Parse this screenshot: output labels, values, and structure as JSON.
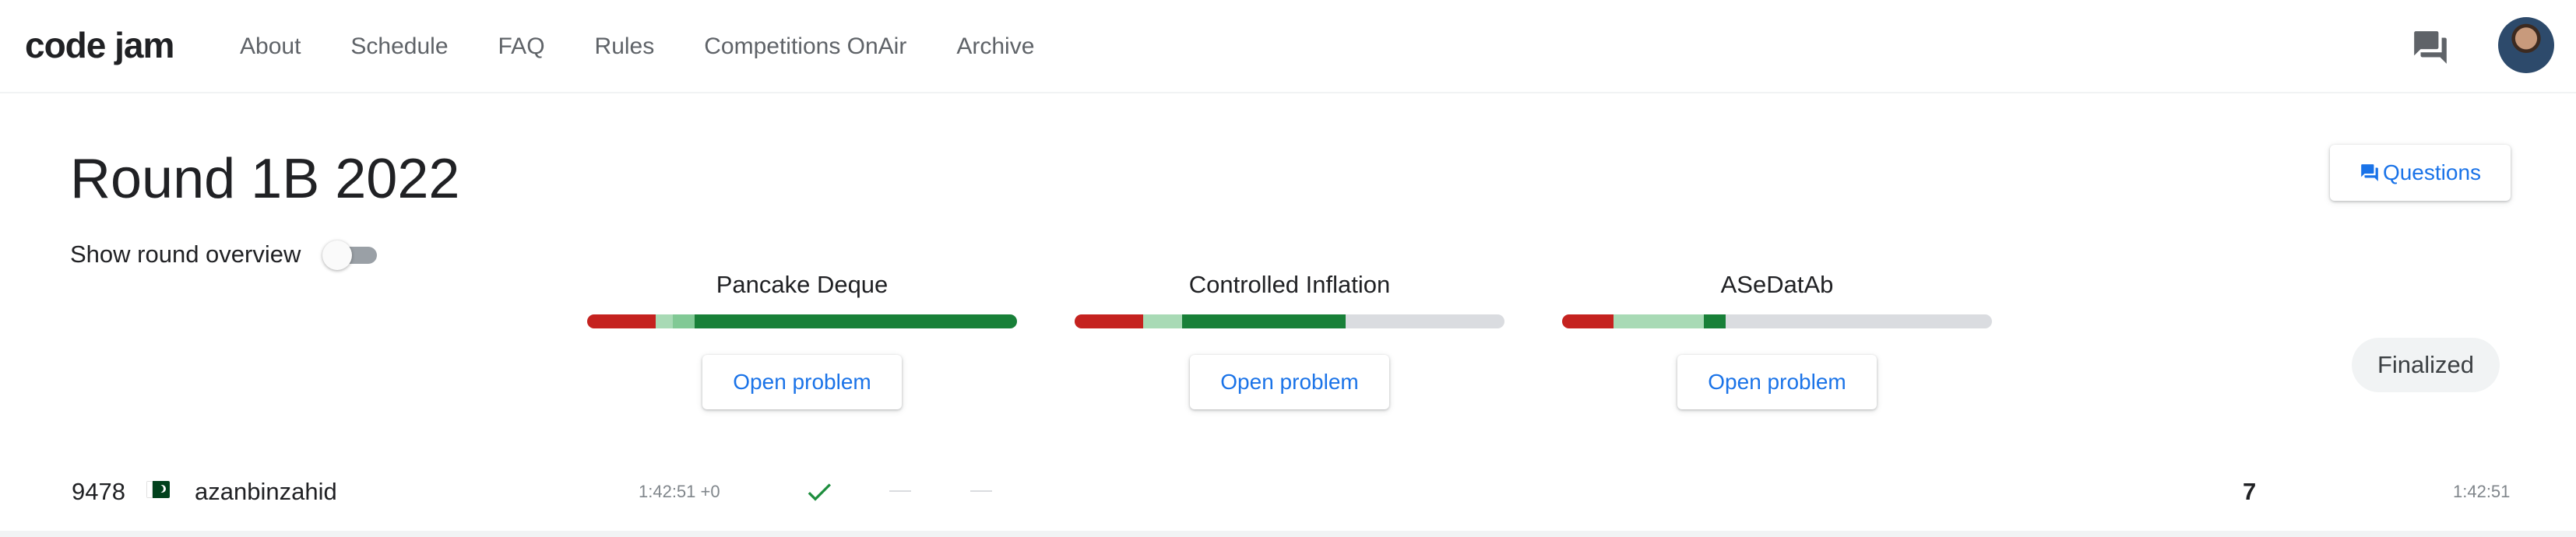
{
  "nav": {
    "brand": "code jam",
    "links": [
      "About",
      "Schedule",
      "FAQ",
      "Rules",
      "Competitions OnAir",
      "Archive"
    ]
  },
  "icons": {
    "chat": "chat-icon",
    "questions": "question-answer-icon",
    "check": "check-icon",
    "flag": "pakistan-flag-icon"
  },
  "colors": {
    "accent": "#1a73e8",
    "solved_green": "#188038",
    "failed_red": "#c5221f",
    "light_green": "#a8dab5",
    "unsolved_gray": "#dadce0"
  },
  "round": {
    "title": "Round 1B 2022",
    "overview_label": "Show round overview",
    "overview_enabled": false,
    "questions_label": "Questions",
    "status": "Finalized"
  },
  "problems": [
    {
      "name": "Pancake Deque",
      "open_label": "Open problem",
      "stats": {
        "red": 0.16,
        "light": 0.04,
        "mid": 0.05,
        "green": 0.75,
        "gray": 0.0
      }
    },
    {
      "name": "Controlled Inflation",
      "open_label": "Open problem",
      "stats": {
        "red": 0.16,
        "light": 0.09,
        "mid": 0.0,
        "green": 0.38,
        "gray": 0.37
      }
    },
    {
      "name": "ASeDatAb",
      "open_label": "Open problem",
      "stats": {
        "red": 0.12,
        "light": 0.21,
        "mid": 0.0,
        "green": 0.05,
        "gray": 0.62
      }
    }
  ],
  "scoreboard": {
    "rows": [
      {
        "rank": "9478",
        "username": "azanbinzahid",
        "problem_time": "1:42:51 +0",
        "score": "7",
        "total_time": "1:42:51"
      }
    ]
  }
}
